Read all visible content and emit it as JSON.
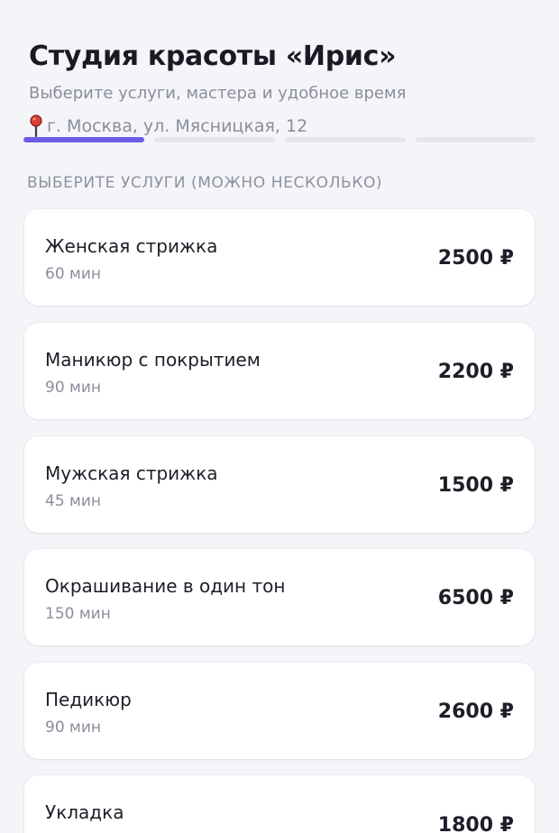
{
  "header": {
    "title": "Студия красоты «Ирис»",
    "subtitle": "Выберите услуги, мастера и удобное время",
    "address": "г. Москва, ул. Мясницкая, 12",
    "address_icon": "map-pin-icon"
  },
  "colors": {
    "accent": "#6f5ce6",
    "pin": "#d94134",
    "background": "#f4f5f9",
    "card": "#ffffff"
  },
  "steps": {
    "total": 4,
    "current": 1
  },
  "section": {
    "label": "ВЫБЕРИТЕ УСЛУГИ (МОЖНО НЕСКОЛЬКО)"
  },
  "services": [
    {
      "name": "Женская стрижка",
      "duration": "60 мин",
      "price": "2500 ₽"
    },
    {
      "name": "Маникюр с покрытием",
      "duration": "90 мин",
      "price": "2200 ₽"
    },
    {
      "name": "Мужская стрижка",
      "duration": "45 мин",
      "price": "1500 ₽"
    },
    {
      "name": "Окрашивание в один тон",
      "duration": "150 мин",
      "price": "6500 ₽"
    },
    {
      "name": "Педикюр",
      "duration": "90 мин",
      "price": "2600 ₽"
    },
    {
      "name": "Укладка",
      "duration": "",
      "price": "1800 ₽"
    }
  ]
}
